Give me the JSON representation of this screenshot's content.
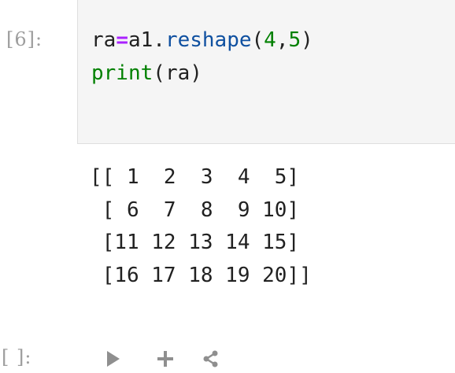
{
  "cells": [
    {
      "prompt": "[6]:",
      "code_lines": [
        {
          "var": "ra",
          "op": "=",
          "obj": "a1.",
          "method": "reshape",
          "open": "(",
          "arg1": "4",
          "comma": ",",
          "arg2": "5",
          "close": ")"
        },
        {
          "builtin": "print",
          "open": "(",
          "arg": "ra",
          "close": ")"
        }
      ],
      "output_lines": [
        "[[ 1  2  3  4  5]",
        " [ 6  7  8  9 10]",
        " [11 12 13 14 15]",
        " [16 17 18 19 20]]"
      ]
    },
    {
      "prompt": "[ ]:",
      "toolbar": [
        "play-icon",
        "plus-icon",
        "share-icon"
      ]
    }
  ],
  "colors": {
    "method": "#0f50a0",
    "number": "#008000",
    "operator": "#aa22ff",
    "cell_background": "#f5f5f5",
    "prompt": "#9e9e9e"
  }
}
